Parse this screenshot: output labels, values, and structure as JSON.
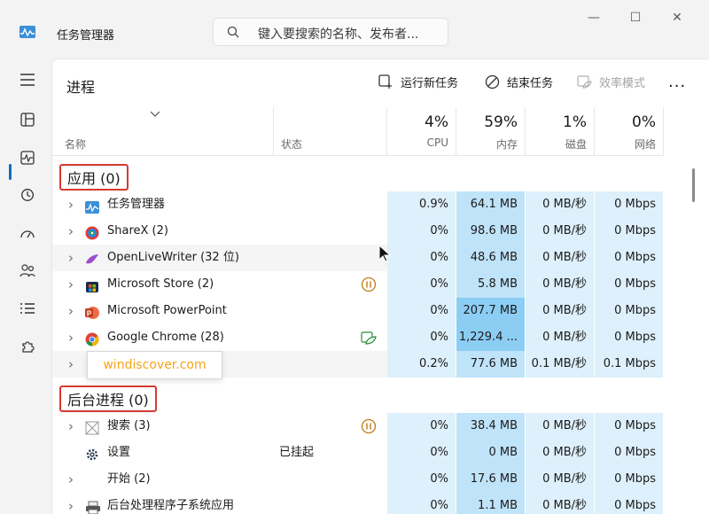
{
  "app": {
    "title": "任务管理器"
  },
  "search": {
    "placeholder": "键入要搜索的名称、发布者..."
  },
  "window_controls": {
    "minimize": "—",
    "maximize": "☐",
    "close": "✕"
  },
  "page": {
    "title": "进程"
  },
  "toolbar": {
    "run_new_task": "运行新任务",
    "end_task": "结束任务",
    "efficiency_mode": "效率模式",
    "more": "..."
  },
  "columns": {
    "name": "名称",
    "status": "状态",
    "cpu": {
      "pct": "4%",
      "label": "CPU"
    },
    "memory": {
      "pct": "59%",
      "label": "内存"
    },
    "disk": {
      "pct": "1%",
      "label": "磁盘"
    },
    "network": {
      "pct": "0%",
      "label": "网络"
    }
  },
  "groups": {
    "apps": "应用 (0)",
    "background": "后台进程 (0)"
  },
  "apps": [
    {
      "name": "任务管理器",
      "icon": "task-manager-icon",
      "status": "",
      "cpu": "0.9%",
      "memory": "64.1 MB",
      "disk": "0 MB/秒",
      "network": "0 Mbps"
    },
    {
      "name": "ShareX (2)",
      "icon": "sharex-icon",
      "status": "",
      "cpu": "0%",
      "memory": "98.6 MB",
      "disk": "0 MB/秒",
      "network": "0 Mbps"
    },
    {
      "name": "OpenLiveWriter (32 位)",
      "icon": "openlivewriter-icon",
      "status": "",
      "cpu": "0%",
      "memory": "48.6 MB",
      "disk": "0 MB/秒",
      "network": "0 Mbps"
    },
    {
      "name": "Microsoft Store (2)",
      "icon": "microsoft-store-icon",
      "status": "",
      "status_icon": "paused-icon",
      "cpu": "0%",
      "memory": "5.8 MB",
      "disk": "0 MB/秒",
      "network": "0 Mbps"
    },
    {
      "name": "Microsoft PowerPoint",
      "icon": "powerpoint-icon",
      "status": "",
      "cpu": "0%",
      "memory": "207.7 MB",
      "disk": "0 MB/秒",
      "network": "0 Mbps"
    },
    {
      "name": "Google Chrome (28)",
      "icon": "chrome-icon",
      "status": "",
      "status_icon": "efficiency-leaf-icon",
      "cpu": "0%",
      "memory": "1,229.4 ...",
      "disk": "0 MB/秒",
      "network": "0 Mbps"
    },
    {
      "name": ")",
      "icon": "",
      "status": "",
      "cpu": "0.2%",
      "memory": "77.6 MB",
      "disk": "0.1 MB/秒",
      "network": "0.1 Mbps"
    }
  ],
  "background": [
    {
      "name": "搜索 (3)",
      "icon": "search-process-icon",
      "status": "",
      "status_icon": "paused-icon",
      "cpu": "0%",
      "memory": "38.4 MB",
      "disk": "0 MB/秒",
      "network": "0 Mbps",
      "expand": true
    },
    {
      "name": "设置",
      "icon": "settings-gear-icon",
      "status": "已挂起",
      "cpu": "0%",
      "memory": "0 MB",
      "disk": "0 MB/秒",
      "network": "0 Mbps",
      "expand": false
    },
    {
      "name": "开始 (2)",
      "icon": "",
      "status": "",
      "cpu": "0%",
      "memory": "17.6 MB",
      "disk": "0 MB/秒",
      "network": "0 Mbps",
      "expand": true
    },
    {
      "name": "后台处理程序子系统应用",
      "icon": "printer-icon",
      "status": "",
      "cpu": "0%",
      "memory": "1.1 MB",
      "disk": "0 MB/秒",
      "network": "0 Mbps",
      "expand": true
    }
  ],
  "watermark": "windiscover.com",
  "colors": {
    "accent": "#0f6cbd",
    "highlight_red": "#d63a32",
    "heat_light": "#ddf0fb",
    "heat_dark": "#8ccdf4"
  }
}
